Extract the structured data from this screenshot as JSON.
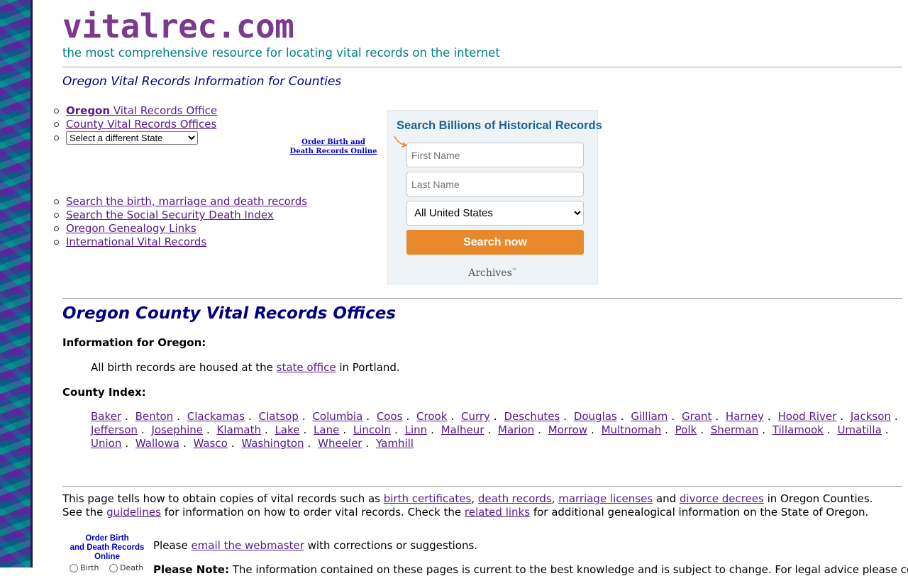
{
  "site": {
    "title": "vitalrec.com",
    "tagline": "the most comprehensive resource for locating vital records on the internet"
  },
  "page_heading": "Oregon Vital Records Information for Counties",
  "nav_top": {
    "oregon_bold": "Oregon",
    "oregon_rest": " Vital Records Office",
    "county_offices": "County Vital Records Offices",
    "state_select": "Select a different State"
  },
  "order_link": {
    "line1": "Order Birth and",
    "line2": "Death Records Online"
  },
  "nav_bottom": [
    "Search the birth, marriage and death records",
    "Search the Social Security Death Index",
    "Oregon Genealogy Links",
    "International Vital Records"
  ],
  "search_widget": {
    "title": "Search Billions of Historical Records",
    "first_name_placeholder": "First Name",
    "last_name_placeholder": "Last Name",
    "location": "All United States",
    "button": "Search now",
    "logo": "Archives",
    "logo_mark": "™",
    "accent_color": "#e8892b",
    "title_color": "#1a6496"
  },
  "section": {
    "title": "Oregon County Vital Records Offices",
    "info_label": "Information for Oregon:",
    "info_text_before": "All birth records are housed at the ",
    "info_link": "state office",
    "info_text_after": " in Portland.",
    "index_label": "County Index:"
  },
  "counties": [
    "Baker",
    "Benton",
    "Clackamas",
    "Clatsop",
    "Columbia",
    "Coos",
    "Crook",
    "Curry",
    "Deschutes",
    "Douglas",
    "Gilliam",
    "Grant",
    "Harney",
    "Hood River",
    "Jackson",
    "Jefferson",
    "Josephine",
    "Klamath",
    "Lake",
    "Lane",
    "Lincoln",
    "Linn",
    "Malheur",
    "Marion",
    "Morrow",
    "Multnomah",
    "Polk",
    "Sherman",
    "Tillamook",
    "Umatilla",
    "Union",
    "Wallowa",
    "Wasco",
    "Washington",
    "Wheeler",
    "Yamhill"
  ],
  "description": {
    "t1": "This page tells how to obtain copies of vital records such as ",
    "l1": "birth certificates",
    "t2": ", ",
    "l2": "death records",
    "t3": ", ",
    "l3": "marriage licenses",
    "t4": " and ",
    "l4": "divorce decrees",
    "t5": " in Oregon Counties. See the ",
    "l5": "guidelines",
    "t6": " for information on how to order vital records. Check the ",
    "l6": "related links",
    "t7": " for additional genealogical information on the State of Oregon."
  },
  "order_badge": {
    "line1": "Order Birth",
    "line2": "and Death Records",
    "line3": "Online",
    "radio1": "Birth",
    "radio2": "Death"
  },
  "contact": {
    "before": "Please ",
    "link": "email the webmaster",
    "after": " with corrections or suggestions."
  },
  "note": {
    "label": "Please Note:",
    "text": " The information contained on these pages is current to the best knowledge and is subject to change. For legal advice please consult a lawyer."
  },
  "colors": {
    "title": "#7b3a8b",
    "tagline": "#008080",
    "heading": "#000080",
    "link": "#551a8b"
  }
}
